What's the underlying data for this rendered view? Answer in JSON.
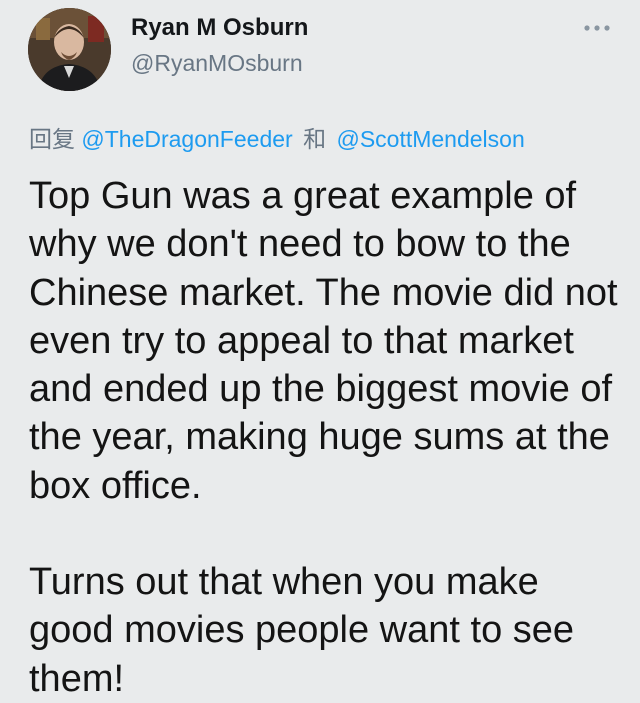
{
  "author": {
    "display_name": "Ryan M Osburn",
    "handle": "@RyanMOsburn"
  },
  "reply": {
    "prefix": "回复",
    "mention_1": "@TheDragonFeeder",
    "joiner": "和",
    "mention_2": "@ScottMendelson"
  },
  "tweet": {
    "paragraph_1": "Top Gun was a great example of why we don't need to bow to the Chinese market. The movie did not even try to appeal to that market and ended up the biggest movie of the year, making huge sums at the box office.",
    "paragraph_2": "Turns out that when you make good movies people want to see them!"
  },
  "icons": {
    "more": "more-options-icon"
  },
  "colors": {
    "background": "#e9ebec",
    "accent": "#1d9bf0",
    "secondary_text": "#687684",
    "primary_text": "#141414"
  }
}
